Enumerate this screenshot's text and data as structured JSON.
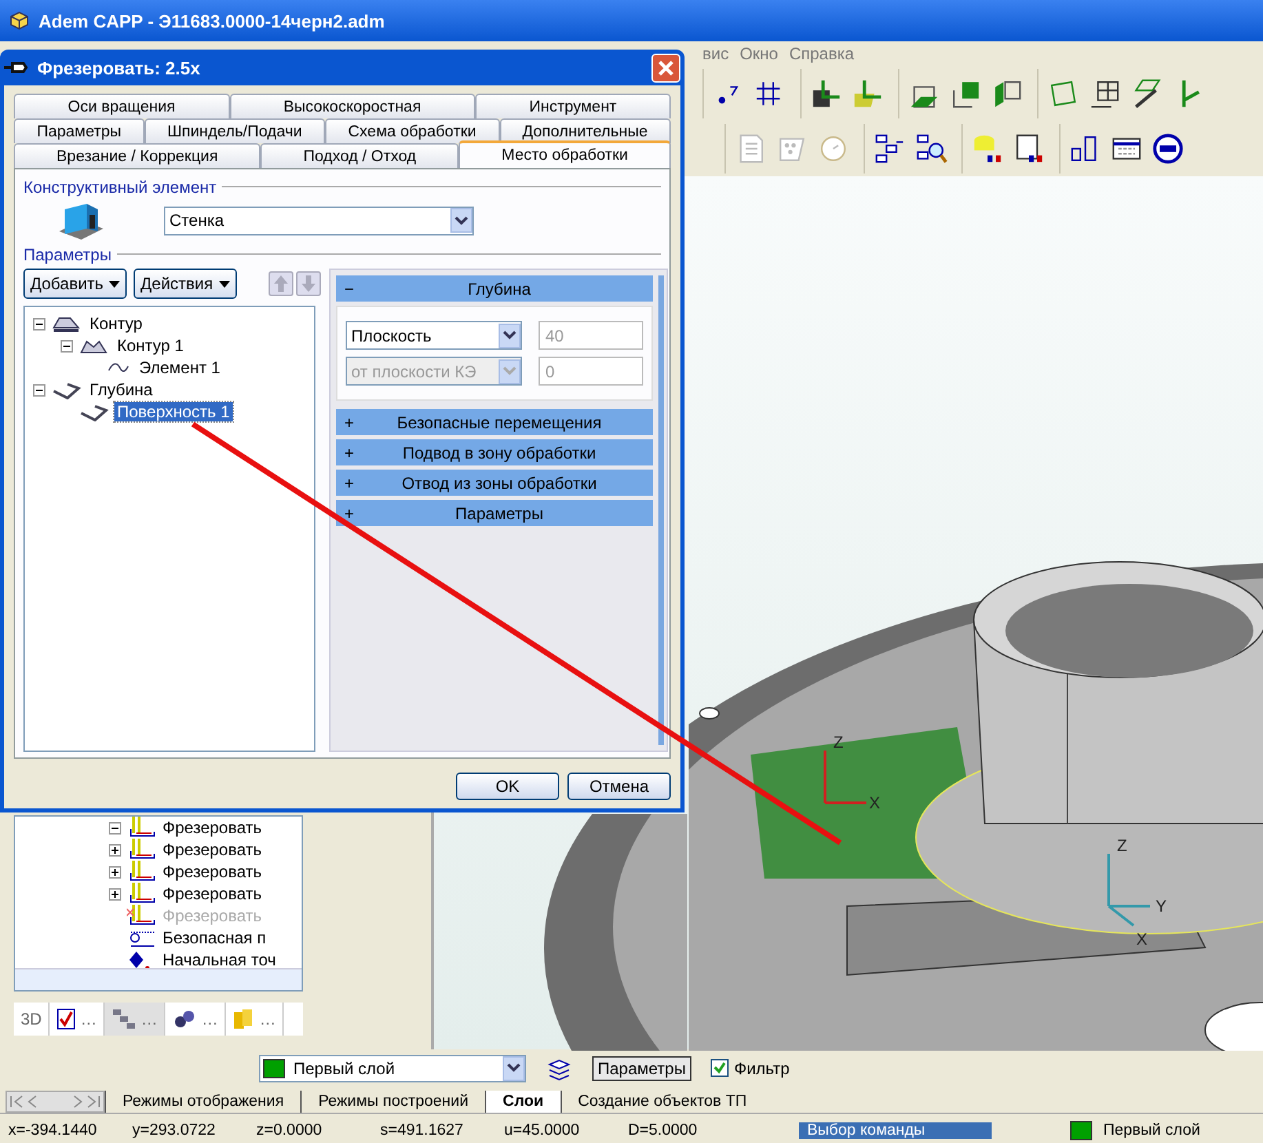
{
  "window": {
    "title": "Adem CAPP - Э11683.0000-14черн2.adm"
  },
  "menu": [
    "вис",
    "Окно",
    "Справка"
  ],
  "left_panel": {
    "tree": [
      {
        "label": "Фрезеровать",
        "expandable": true,
        "expanded": true,
        "disabled": false,
        "kind": "mill"
      },
      {
        "label": "Фрезеровать",
        "expandable": true,
        "expanded": false,
        "disabled": false,
        "kind": "mill"
      },
      {
        "label": "Фрезеровать",
        "expandable": true,
        "expanded": false,
        "disabled": false,
        "kind": "mill"
      },
      {
        "label": "Фрезеровать",
        "expandable": true,
        "expanded": false,
        "disabled": false,
        "kind": "mill"
      },
      {
        "label": "Фрезеровать",
        "expandable": false,
        "disabled": true,
        "kind": "mill"
      },
      {
        "label": "Безопасная п",
        "expandable": false,
        "disabled": false,
        "kind": "safe"
      },
      {
        "label": "Начальная точ",
        "expandable": false,
        "disabled": false,
        "kind": "start"
      }
    ],
    "tabs": [
      {
        "kind": "text",
        "label": "3D",
        "selected": false
      },
      {
        "kind": "report",
        "label": "…",
        "selected": false
      },
      {
        "kind": "tree",
        "label": "…",
        "selected": true
      },
      {
        "kind": "gears",
        "label": "…",
        "selected": false
      },
      {
        "kind": "db",
        "label": "…",
        "selected": false
      }
    ]
  },
  "viewport": {
    "triads": [
      {
        "z": "Z",
        "x": "X"
      },
      {
        "z": "Z",
        "y": "Y",
        "x": "X"
      }
    ]
  },
  "dialog": {
    "title": "Фрезеровать: 2.5x",
    "tab_rows": [
      [
        {
          "label": "Оси вращения",
          "selected": false
        },
        {
          "label": "Высокоскоростная",
          "selected": false
        },
        {
          "label": "Инструмент",
          "selected": false
        }
      ],
      [
        {
          "label": "Параметры",
          "selected": false
        },
        {
          "label": "Шпиндель/Подачи",
          "selected": false
        },
        {
          "label": "Схема обработки",
          "selected": false
        },
        {
          "label": "Дополнительные",
          "selected": false
        }
      ],
      [
        {
          "label": "Врезание / Коррекция",
          "selected": false
        },
        {
          "label": "Подход / Отход",
          "selected": false
        },
        {
          "label": "Место обработки",
          "selected": true
        }
      ]
    ],
    "element_group": "Конструктивный элемент",
    "element_value": "Стенка",
    "params_group": "Параметры",
    "buttons": [
      "Добавить",
      "Действия"
    ],
    "tree": [
      {
        "label": "Контур",
        "kind": "contour",
        "expanded": true,
        "selected": false,
        "children": [
          {
            "label": "Контур 1",
            "kind": "contour1",
            "expanded": true,
            "selected": false,
            "children": [
              {
                "label": "Элемент 1",
                "kind": "curve",
                "selected": false
              }
            ]
          }
        ]
      },
      {
        "label": "Глубина",
        "kind": "depth",
        "expanded": true,
        "selected": false,
        "children": [
          {
            "label": "Поверхность 1",
            "kind": "depth",
            "selected": true
          }
        ]
      }
    ],
    "sections": [
      {
        "toggle": "−",
        "title": "Глубина",
        "expanded": true,
        "fields": [
          {
            "kind": "select",
            "value": "Плоскость",
            "disabled": false
          },
          {
            "kind": "input",
            "value": "40",
            "disabled": true
          },
          {
            "kind": "select",
            "value": "от плоскости КЭ",
            "disabled": true
          },
          {
            "kind": "input",
            "value": "0",
            "disabled": true
          }
        ]
      },
      {
        "toggle": "+",
        "title": "Безопасные перемещения",
        "expanded": false
      },
      {
        "toggle": "+",
        "title": "Подвод в зону обработки",
        "expanded": false
      },
      {
        "toggle": "+",
        "title": "Отвод из зоны обработки",
        "expanded": false
      },
      {
        "toggle": "+",
        "title": "Параметры",
        "expanded": false
      }
    ],
    "ok": "OK",
    "cancel": "Отмена"
  },
  "bottom_bar": {
    "layer": {
      "label": "Первый слой",
      "color": "#00a000"
    },
    "params_button": "Параметры",
    "filter": {
      "label": "Фильтр",
      "checked": true
    }
  },
  "bottom_tabs": [
    {
      "label": "Режимы отображения",
      "selected": false
    },
    {
      "label": "Режимы построений",
      "selected": false
    },
    {
      "label": "Слои",
      "selected": true
    },
    {
      "label": "Создание объектов ТП",
      "selected": false
    }
  ],
  "status_bar": {
    "fields": [
      {
        "kind": "coord",
        "text": "x=-394.1440"
      },
      {
        "kind": "coord",
        "text": "y=293.0722"
      },
      {
        "kind": "coord",
        "text": "z=0.0000"
      },
      {
        "kind": "coord",
        "text": "s=491.1627"
      },
      {
        "kind": "coord",
        "text": "u=45.0000"
      },
      {
        "kind": "coord",
        "text": "D=5.0000"
      },
      {
        "kind": "message",
        "text": "Выбор команды"
      }
    ],
    "layer": {
      "label": "Первый слой",
      "color": "#00a000"
    }
  }
}
